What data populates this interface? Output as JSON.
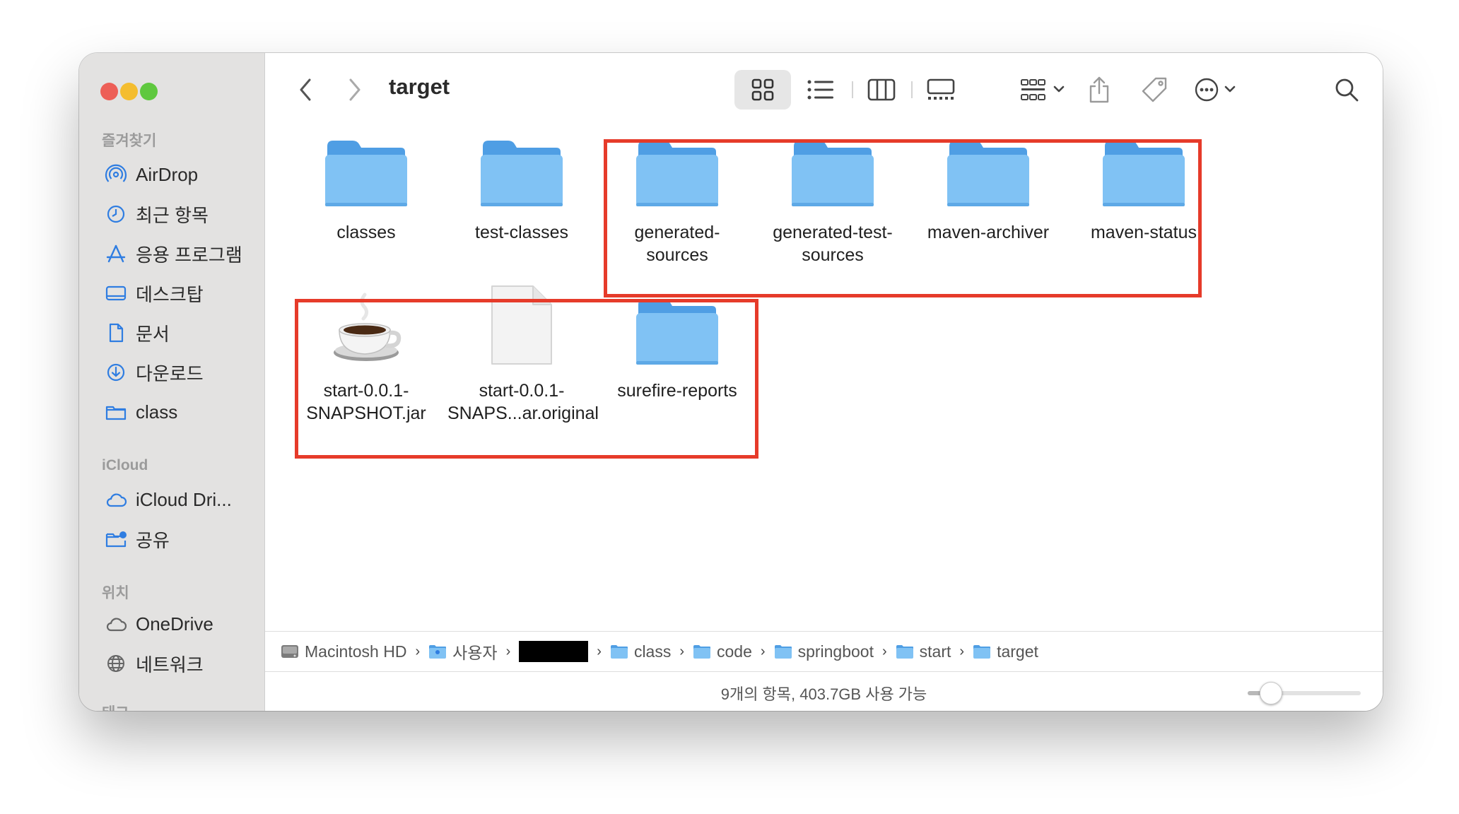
{
  "window": {
    "title": "target"
  },
  "colors": {
    "accent": "#2f7de1",
    "folder": "#78bdf3",
    "highlight": "#e63b2a"
  },
  "sidebar": {
    "favorites_label": "즐겨찾기",
    "favorites": [
      {
        "label": "AirDrop",
        "icon": "airdrop-icon"
      },
      {
        "label": "최근 항목",
        "icon": "clock-icon"
      },
      {
        "label": "응용 프로그램",
        "icon": "applications-icon"
      },
      {
        "label": "데스크탑",
        "icon": "desktop-icon"
      },
      {
        "label": "문서",
        "icon": "document-icon"
      },
      {
        "label": "다운로드",
        "icon": "download-icon"
      },
      {
        "label": "class",
        "icon": "folder-icon"
      }
    ],
    "icloud_label": "iCloud",
    "icloud": [
      {
        "label": "iCloud Dri...",
        "icon": "cloud-icon"
      },
      {
        "label": "공유",
        "icon": "shared-folder-icon"
      }
    ],
    "locations_label": "위치",
    "locations": [
      {
        "label": "OneDrive",
        "icon": "cloud-icon"
      },
      {
        "label": "네트워크",
        "icon": "globe-icon"
      }
    ],
    "tags_label": "태그"
  },
  "files": [
    {
      "name": "classes",
      "type": "folder"
    },
    {
      "name": "test-classes",
      "type": "folder"
    },
    {
      "name": "generated-sources",
      "type": "folder"
    },
    {
      "name": "generated-test-sources",
      "type": "folder"
    },
    {
      "name": "maven-archiver",
      "type": "folder"
    },
    {
      "name": "maven-status",
      "type": "folder"
    },
    {
      "name": "start-0.0.1-SNAPSHOT.jar",
      "type": "jar"
    },
    {
      "name": "start-0.0.1-SNAPS...ar.original",
      "type": "document"
    },
    {
      "name": "surefire-reports",
      "type": "folder"
    }
  ],
  "file_labels": {
    "f0": [
      "classes"
    ],
    "f1": [
      "test-classes"
    ],
    "f2": [
      "generated-",
      "sources"
    ],
    "f3": [
      "generated-test-",
      "sources"
    ],
    "f4": [
      "maven-archiver"
    ],
    "f5": [
      "maven-status"
    ],
    "f6": [
      "start-0.0.1-",
      "SNAPSHOT.jar"
    ],
    "f7": [
      "start-0.0.1-",
      "SNAPS...ar.original"
    ],
    "f8": [
      "surefire-reports"
    ]
  },
  "pathbar": {
    "items": [
      "Macintosh HD",
      "사용자",
      "",
      "class",
      "code",
      "springboot",
      "start",
      "target"
    ]
  },
  "status": {
    "text": "9개의 항목, 403.7GB 사용 가능",
    "zoom_fraction": 0.2
  }
}
